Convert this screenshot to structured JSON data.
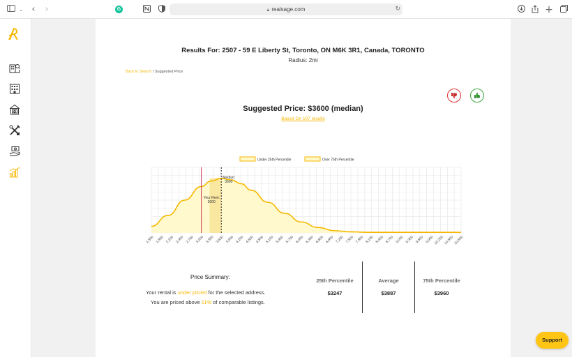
{
  "browser": {
    "url": "realsage.com",
    "icons": [
      "sidebar-toggle-icon",
      "chevron-down-icon",
      "back-icon",
      "forward-icon",
      "grammarly-icon",
      "notion-icon",
      "shield-icon",
      "lock-icon",
      "reload-icon",
      "download-icon",
      "share-icon",
      "new-tab-icon",
      "tabs-overview-icon"
    ]
  },
  "sidebar": {
    "icons": [
      "realsage-logo",
      "building-search-icon",
      "building-chart-icon",
      "building-money-icon",
      "tools-icon",
      "hand-money-icon",
      "bar-chart-icon"
    ],
    "accent": "#f5b800"
  },
  "header": {
    "title": "Results For: 2507 - 59 E Liberty St, Toronto, ON M6K 3R1, Canada, TORONTO",
    "radius": "Radius: 2mi"
  },
  "breadcrumb": {
    "link": "Back to Search",
    "sep": " / ",
    "current": "Suggested Price"
  },
  "feedback": {
    "down_icon": "thumbs-down-icon",
    "up_icon": "thumbs-up-icon",
    "down_color": "#e03030",
    "up_color": "#3aa53a"
  },
  "suggested": {
    "label": "Suggested Price: $3600 (median)",
    "based_on": "Based On 107 results"
  },
  "chart_data": {
    "type": "area",
    "legend": [
      "Under 25th Percentile",
      "Over 75th Percentile"
    ],
    "legend_position": "top-center",
    "x_ticks": [
      "1,500",
      "1,800",
      "2,100",
      "2,400",
      "2,700",
      "3,000",
      "3,300",
      "3,600",
      "3,900",
      "4,200",
      "4,500",
      "4,800",
      "5,100",
      "5,400",
      "5,700",
      "6,000",
      "6,300",
      "6,600",
      "6,900",
      "7,200",
      "7,500",
      "7,800",
      "8,100",
      "8,400",
      "8,700",
      "9,000",
      "9,300",
      "9,600",
      "9,900",
      "10,200",
      "10,500",
      "10,800"
    ],
    "xlim": [
      1500,
      10800
    ],
    "x": [
      1500,
      2000,
      2500,
      3000,
      3300,
      3600,
      3900,
      4200,
      4500,
      5000,
      5500,
      6000,
      6500,
      7000,
      7500,
      8000,
      8500,
      9000,
      10800
    ],
    "y": [
      0.12,
      0.32,
      0.6,
      0.85,
      0.95,
      1.0,
      0.97,
      0.9,
      0.78,
      0.56,
      0.36,
      0.2,
      0.1,
      0.04,
      0.02,
      0.01,
      0.01,
      0.01,
      0.01
    ],
    "ylim": [
      0,
      1.2
    ],
    "grid": true,
    "markers": {
      "your_rent": {
        "value": 3000,
        "label_line1": "Your Rent:",
        "label_line2": "3000"
      },
      "median": {
        "value": 3600,
        "label_line1": "Median:",
        "label_line2": "3600"
      }
    },
    "percentile_band": [
      3247,
      3600
    ],
    "colors": {
      "line": "#f5b800",
      "fill": "#fff8c8",
      "band": "#fae7a0",
      "your_rent": "#d0305a",
      "median": "#222222"
    }
  },
  "summary": {
    "title": "Price Summary:",
    "line1_pre": "Your rental is ",
    "line1_hl": "under priced",
    "line1_post": " for the selected address.",
    "line2_pre": "You are priced above ",
    "line2_hl": "11%",
    "line2_post": " of comparable listings.",
    "stats": [
      {
        "label": "25th Percentile",
        "value": "$3247"
      },
      {
        "label": "Average",
        "value": "$3887"
      },
      {
        "label": "75th Percentile",
        "value": "$3960"
      }
    ]
  },
  "support": {
    "label": "Support"
  }
}
